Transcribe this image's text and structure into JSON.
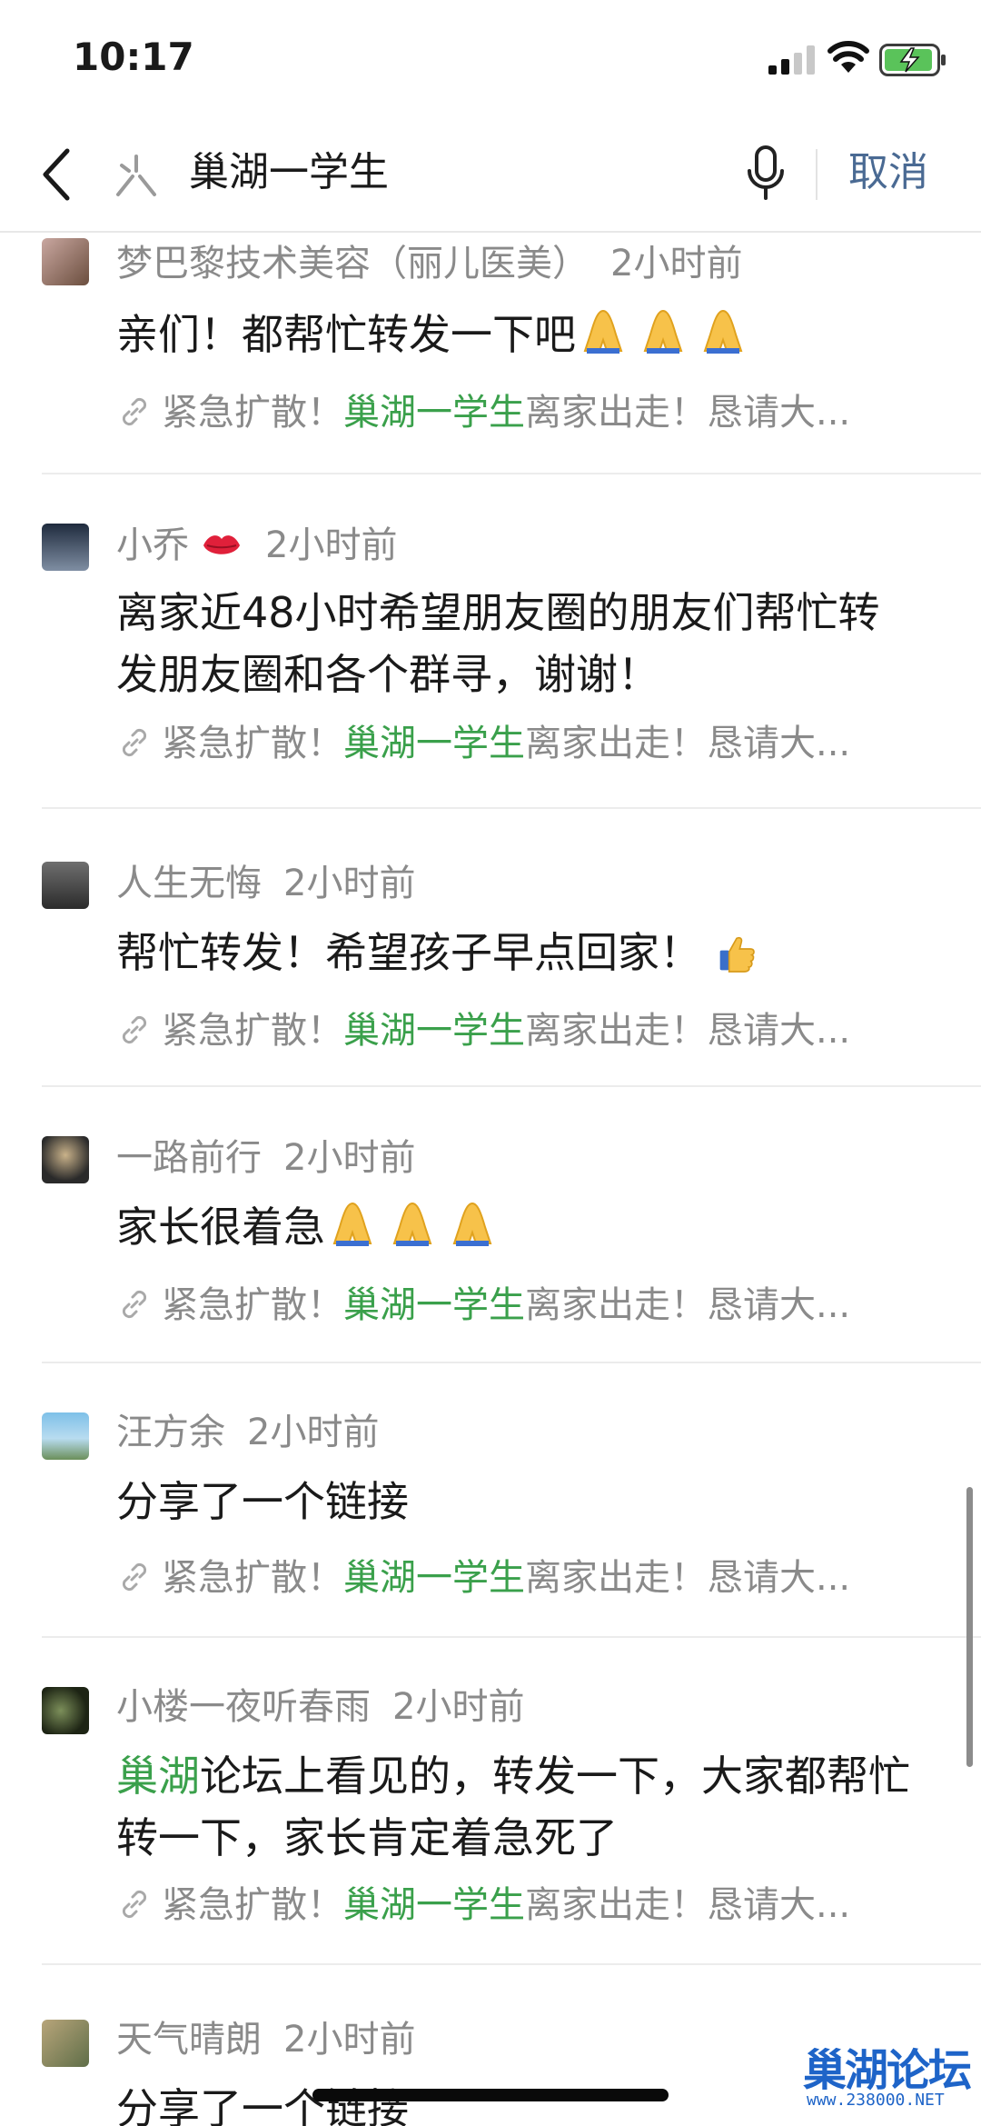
{
  "status_bar": {
    "time": "10:17"
  },
  "search": {
    "query": "巢湖一学生",
    "cancel_label": "取消"
  },
  "link_text": {
    "prefix": "紧急扩散！",
    "highlight": "巢湖一学生",
    "suffix": "离家出走！恳请大..."
  },
  "posts": [
    {
      "author": "梦巴黎技术美容（丽儿医美）",
      "time": "2小时前",
      "content": "亲们！都帮忙转发一下吧",
      "emojis": [
        "pray",
        "pray",
        "pray"
      ]
    },
    {
      "author": "小乔",
      "time": "2小时前",
      "content": "离家近48小时希望朋友圈的朋友们帮忙转发朋友圈和各个群寻，谢谢！",
      "author_emoji": "kiss-lips"
    },
    {
      "author": "人生无悔",
      "time": "2小时前",
      "content": "帮忙转发！希望孩子早点回家！",
      "emojis": [
        "thumbs-up"
      ]
    },
    {
      "author": "一路前行",
      "time": "2小时前",
      "content": "家长很着急",
      "emojis": [
        "pray",
        "pray",
        "pray"
      ]
    },
    {
      "author": "汪方余",
      "time": "2小时前",
      "content": "分享了一个链接"
    },
    {
      "author": "小楼一夜听春雨",
      "time": "2小时前",
      "content_highlight": "巢湖",
      "content": "论坛上看见的，转发一下，大家都帮忙转一下，家长肯定着急死了"
    },
    {
      "author": "天气晴朗",
      "time": "2小时前",
      "content": "分享了一个链接"
    }
  ],
  "watermark": {
    "title": "巢湖论坛",
    "url": "www.238000.NET"
  },
  "colors": {
    "accent_green": "#3aa04b",
    "cancel_blue": "#4a6a93",
    "meta_gray": "#8a8a8a"
  }
}
